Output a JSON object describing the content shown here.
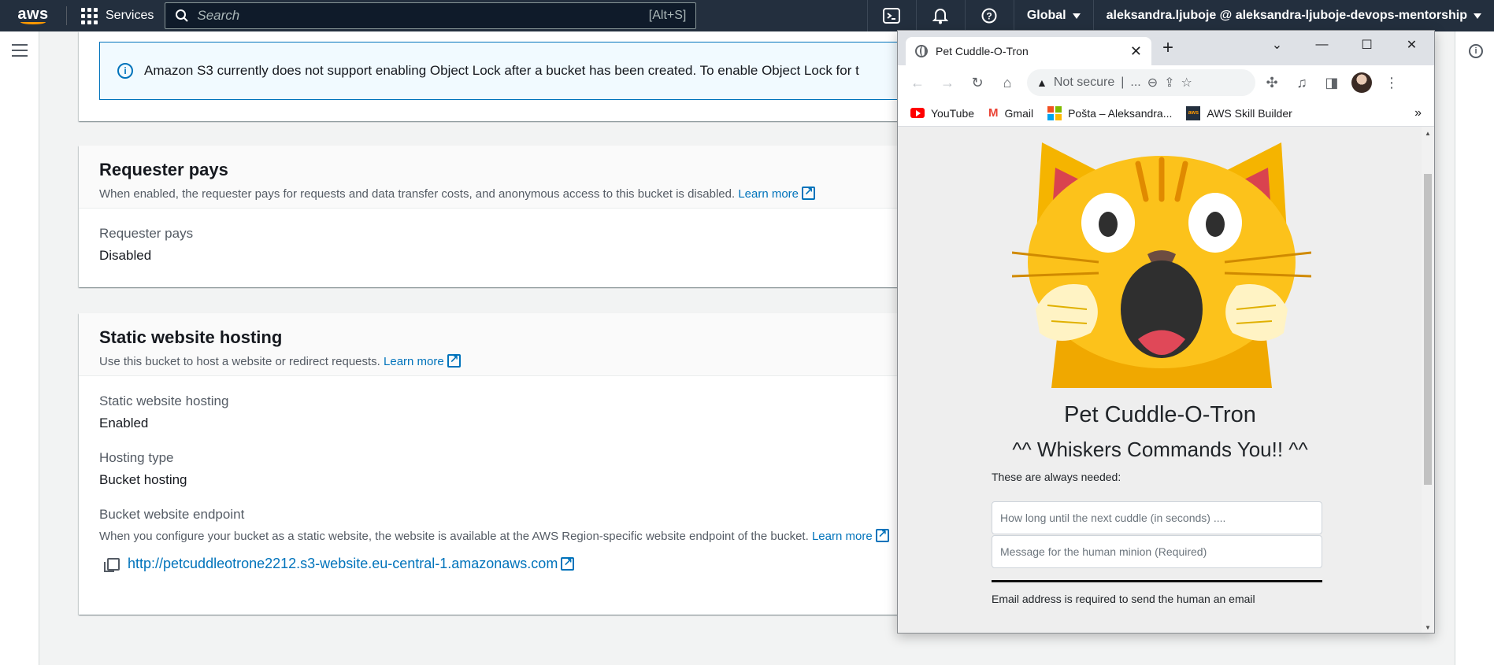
{
  "aws_nav": {
    "logo": "aws",
    "services_label": "Services",
    "search_placeholder": "Search",
    "search_shortcut": "[Alt+S]",
    "region": "Global",
    "account": "aleksandra.ljuboje @ aleksandra-ljuboje-devops-mentorship",
    "icons": [
      "cloudshell-icon",
      "bell-icon",
      "help-icon"
    ]
  },
  "alert": {
    "text": "Amazon S3 currently does not support enabling Object Lock after a bucket has been created. To enable Object Lock for t"
  },
  "requester_pays": {
    "title": "Requester pays",
    "description": "When enabled, the requester pays for requests and data transfer costs, and anonymous access to this bucket is disabled.",
    "learn_more": "Learn more",
    "field_label": "Requester pays",
    "field_value": "Disabled"
  },
  "static_hosting": {
    "title": "Static website hosting",
    "description": "Use this bucket to host a website or redirect requests.",
    "learn_more": "Learn more",
    "hosting_label": "Static website hosting",
    "hosting_value": "Enabled",
    "type_label": "Hosting type",
    "type_value": "Bucket hosting",
    "endpoint_label": "Bucket website endpoint",
    "endpoint_desc": "When you configure your bucket as a static website, the website is available at the AWS Region-specific website endpoint of the bucket.",
    "endpoint_learn_more": "Learn more",
    "endpoint_url": "http://petcuddleotrone2212.s3-website.eu-central-1.amazonaws.com"
  },
  "browser": {
    "tab_title": "Pet Cuddle-O-Tron",
    "omnibox": "Not secure",
    "omnibox_more": "...",
    "bookmarks": [
      {
        "label": "YouTube",
        "icon": "youtube-icon"
      },
      {
        "label": "Gmail",
        "icon": "gmail-icon"
      },
      {
        "label": "Pošta – Aleksandra...",
        "icon": "microsoft-icon"
      },
      {
        "label": "AWS Skill Builder",
        "icon": "aws-icon"
      }
    ],
    "bookmarks_more": "»"
  },
  "page": {
    "title": "Pet Cuddle-O-Tron",
    "subtitle": "^^ Whiskers Commands You!! ^^",
    "always_needed": "These are always needed:",
    "field1_placeholder": "How long until the next cuddle (in seconds) ....",
    "field2_placeholder": "Message for the human minion (Required)",
    "email_note": "Email address is required to send the human an email"
  },
  "colors": {
    "aws_nav": "#232f3e",
    "aws_orange": "#ff9900",
    "link": "#0073bb",
    "alert_bg": "#f1faff"
  }
}
